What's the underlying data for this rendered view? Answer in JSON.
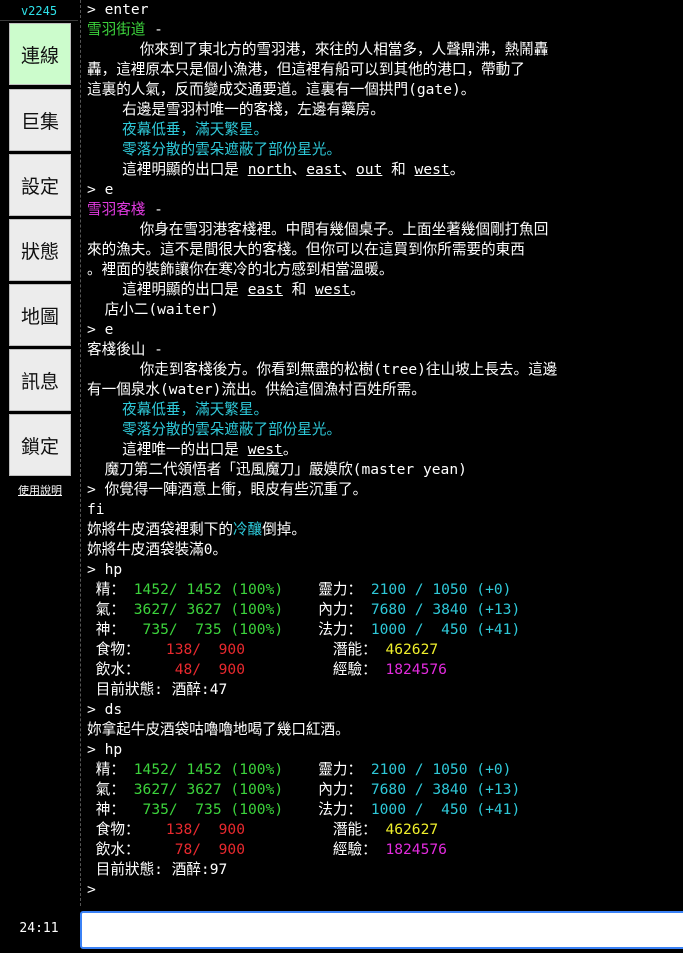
{
  "sidebar": {
    "version": "v2245",
    "buttons": [
      {
        "label": "連線",
        "active": true
      },
      {
        "label": "巨集",
        "active": false
      },
      {
        "label": "設定",
        "active": false
      },
      {
        "label": "狀態",
        "active": false
      },
      {
        "label": "地圖",
        "active": false
      },
      {
        "label": "訊息",
        "active": false
      },
      {
        "label": "鎖定",
        "active": false
      }
    ],
    "help_label": "使用說明",
    "clock": "24:11"
  },
  "terminal": {
    "lines": [
      [
        {
          "t": "> enter"
        }
      ],
      [
        {
          "t": "雪羽街道",
          "c": "c-green"
        },
        {
          "t": " -"
        }
      ],
      [
        {
          "t": "      你來到了東北方的雪羽港，來往的人相當多，人聲鼎沸，熱鬧轟"
        }
      ],
      [
        {
          "t": "轟，這裡原本只是個小漁港，但這裡有船可以到其他的港口，帶動了"
        }
      ],
      [
        {
          "t": "這裏的人氣，反而變成交通要道。這裏有一個拱門(gate)。"
        }
      ],
      [
        {
          "t": "    右邊是雪羽村唯一的客棧，左邊有藥房。"
        }
      ],
      [
        {
          "t": "    夜幕低垂，滿天繁星。",
          "c": "c-cyan"
        }
      ],
      [
        {
          "t": "    零落分散的雲朵遮蔽了部份星光。",
          "c": "c-cyan"
        }
      ],
      [
        {
          "t": "    這裡明顯的出口是 "
        },
        {
          "t": "north",
          "u": true
        },
        {
          "t": "、"
        },
        {
          "t": "east",
          "u": true
        },
        {
          "t": "、"
        },
        {
          "t": "out",
          "u": true
        },
        {
          "t": " 和 "
        },
        {
          "t": "west",
          "u": true
        },
        {
          "t": "。"
        }
      ],
      [
        {
          "t": "> e"
        }
      ],
      [
        {
          "t": "雪羽客棧",
          "c": "c-magenta"
        },
        {
          "t": " -"
        }
      ],
      [
        {
          "t": "      你身在雪羽港客棧裡。中間有幾個桌子。上面坐著幾個剛打魚回"
        }
      ],
      [
        {
          "t": "來的漁夫。這不是間很大的客棧。但你可以在這買到你所需要的東西"
        }
      ],
      [
        {
          "t": "。裡面的裝飾讓你在寒冷的北方感到相當溫暖。"
        }
      ],
      [
        {
          "t": "    這裡明顯的出口是 "
        },
        {
          "t": "east",
          "u": true
        },
        {
          "t": " 和 "
        },
        {
          "t": "west",
          "u": true
        },
        {
          "t": "。"
        }
      ],
      [
        {
          "t": "  店小二(waiter)"
        }
      ],
      [
        {
          "t": "> e"
        }
      ],
      [
        {
          "t": "客棧後山 -"
        }
      ],
      [
        {
          "t": "      你走到客棧後方。你看到無盡的松樹(tree)往山坡上長去。這邊"
        }
      ],
      [
        {
          "t": "有一個泉水(water)流出。供給這個漁村百姓所需。"
        }
      ],
      [
        {
          "t": "    夜幕低垂，滿天繁星。",
          "c": "c-cyan"
        }
      ],
      [
        {
          "t": "    零落分散的雲朵遮蔽了部份星光。",
          "c": "c-cyan"
        }
      ],
      [
        {
          "t": "    這裡唯一的出口是 "
        },
        {
          "t": "west",
          "u": true
        },
        {
          "t": "。"
        }
      ],
      [
        {
          "t": "  魔刀第二代領悟者「迅風魔刀」嚴嫫欣(master yean)"
        }
      ],
      [
        {
          "t": "> 你覺得一陣酒意上衝，眼皮有些沉重了。"
        }
      ],
      [
        {
          "t": "fi"
        }
      ],
      [
        {
          "t": "妳將牛皮酒袋裡剩下的"
        },
        {
          "t": "冷釀",
          "c": "c-cyan"
        },
        {
          "t": "倒掉。"
        }
      ],
      [
        {
          "t": "妳將牛皮酒袋裝滿0。"
        }
      ],
      [
        {
          "t": "> hp"
        }
      ],
      [
        {
          "t": " 精： "
        },
        {
          "t": "1452/ 1452 (100%)",
          "c": "c-green"
        },
        {
          "t": "    靈力： "
        },
        {
          "t": "2100 / 1050 (+0)",
          "c": "c-cyan"
        }
      ],
      [
        {
          "t": " 氣： "
        },
        {
          "t": "3627/ 3627 (100%)",
          "c": "c-green"
        },
        {
          "t": "    內力： "
        },
        {
          "t": "7680 / 3840 (+13)",
          "c": "c-cyan"
        }
      ],
      [
        {
          "t": " 神：  "
        },
        {
          "t": "735/  735 (100%)",
          "c": "c-green"
        },
        {
          "t": "    法力： "
        },
        {
          "t": "1000 /  450 (+41)",
          "c": "c-cyan"
        }
      ],
      [
        {
          "t": " 食物：  "
        },
        {
          "t": " 138/",
          "c": "c-red"
        },
        {
          "t": "  900",
          "c": "c-red"
        },
        {
          "t": "          潛能： "
        },
        {
          "t": "462627",
          "c": "c-yellow"
        }
      ],
      [
        {
          "t": " 飲水：  "
        },
        {
          "t": "  48/",
          "c": "c-red"
        },
        {
          "t": "  900",
          "c": "c-red"
        },
        {
          "t": "          經驗： "
        },
        {
          "t": "1824576",
          "c": "c-mag2"
        }
      ],
      [
        {
          "t": " 目前狀態: 酒醉:47"
        }
      ],
      [
        {
          "t": "> ds"
        }
      ],
      [
        {
          "t": "妳拿起牛皮酒袋咕嚕嚕地喝了幾口紅酒。"
        }
      ],
      [
        {
          "t": "> hp"
        }
      ],
      [
        {
          "t": " 精： "
        },
        {
          "t": "1452/ 1452 (100%)",
          "c": "c-green"
        },
        {
          "t": "    靈力： "
        },
        {
          "t": "2100 / 1050 (+0)",
          "c": "c-cyan"
        }
      ],
      [
        {
          "t": " 氣： "
        },
        {
          "t": "3627/ 3627 (100%)",
          "c": "c-green"
        },
        {
          "t": "    內力： "
        },
        {
          "t": "7680 / 3840 (+13)",
          "c": "c-cyan"
        }
      ],
      [
        {
          "t": " 神：  "
        },
        {
          "t": "735/  735 (100%)",
          "c": "c-green"
        },
        {
          "t": "    法力： "
        },
        {
          "t": "1000 /  450 (+41)",
          "c": "c-cyan"
        }
      ],
      [
        {
          "t": " 食物：  "
        },
        {
          "t": " 138/",
          "c": "c-red"
        },
        {
          "t": "  900",
          "c": "c-red"
        },
        {
          "t": "          潛能： "
        },
        {
          "t": "462627",
          "c": "c-yellow"
        }
      ],
      [
        {
          "t": " 飲水：  "
        },
        {
          "t": "  78/",
          "c": "c-red"
        },
        {
          "t": "  900",
          "c": "c-red"
        },
        {
          "t": "          經驗： "
        },
        {
          "t": "1824576",
          "c": "c-mag2"
        }
      ],
      [
        {
          "t": " 目前狀態: 酒醉:97"
        }
      ],
      [
        {
          "t": ">"
        }
      ]
    ]
  },
  "input": {
    "value": "",
    "placeholder": ""
  },
  "colors": {
    "background": "#000000",
    "green": "#3cd33c",
    "cyan": "#2ec8d8",
    "magenta": "#e13be0",
    "red": "#e8292e",
    "yellow": "#eeee2b",
    "active_button": "#ccfccc",
    "input_border": "#3b82f6"
  }
}
